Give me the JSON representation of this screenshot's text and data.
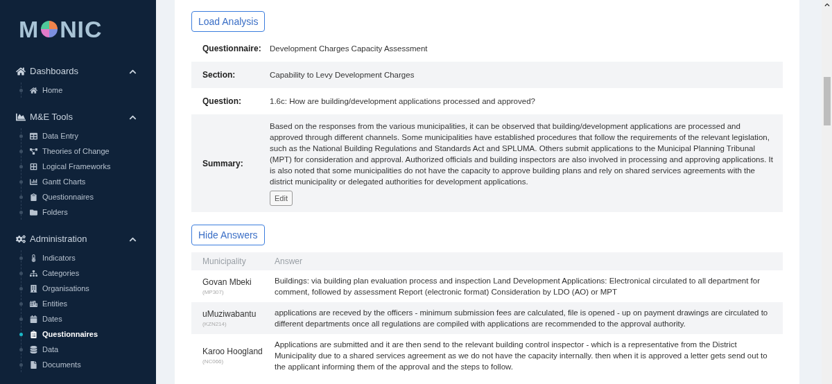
{
  "logo": {
    "before": "M",
    "after": "NIC"
  },
  "sidebar": {
    "sections": [
      {
        "title": "Dashboards",
        "expanded": true,
        "items": [
          {
            "label": "Home",
            "selected": false
          }
        ]
      },
      {
        "title": "M&E Tools",
        "expanded": true,
        "items": [
          {
            "label": "Data Entry",
            "selected": false
          },
          {
            "label": "Theories of Change",
            "selected": false
          },
          {
            "label": "Logical Frameworks",
            "selected": false
          },
          {
            "label": "Gantt Charts",
            "selected": false
          },
          {
            "label": "Questionnaires",
            "selected": false
          },
          {
            "label": "Folders",
            "selected": false
          }
        ]
      },
      {
        "title": "Administration",
        "expanded": true,
        "items": [
          {
            "label": "Indicators",
            "selected": false
          },
          {
            "label": "Categories",
            "selected": false
          },
          {
            "label": "Organisations",
            "selected": false
          },
          {
            "label": "Entities",
            "selected": false
          },
          {
            "label": "Dates",
            "selected": false
          },
          {
            "label": "Questionnaires",
            "selected": true
          },
          {
            "label": "Data",
            "selected": false
          },
          {
            "label": "Documents",
            "selected": false
          }
        ]
      }
    ]
  },
  "analysis": {
    "button": "Load Analysis",
    "details": [
      {
        "label": "Questionnaire:",
        "value": "Development Charges Capacity Assessment"
      },
      {
        "label": "Section:",
        "value": "Capability to Levy Development Charges"
      },
      {
        "label": "Question:",
        "value": "1.6c: How are building/development applications processed and approved?"
      },
      {
        "label": "Summary:",
        "value": "Based on the responses from the various municipalities, it can be observed that building/development applications are processed and approved through different channels. Some municipalities have established procedures that follow the requirements of the relevant legislation, such as the National Building Regulations and Standards Act and SPLUMA. Others submit applications to the Municipal Planning Tribunal (MPT) for consideration and approval. Authorized officials and building inspectors are also involved in processing and approving applications. It is also noted that some municipalities do not have the capacity to approve building plans and rely on shared services agreements with the district municipality or delegated authorities for development applications.",
        "edit_button": "Edit"
      }
    ]
  },
  "answers": {
    "button": "Hide Answers",
    "columns": [
      "Municipality",
      "Answer"
    ],
    "rows": [
      {
        "municipality": "Govan Mbeki",
        "code": "(MP307)",
        "answer": "Buildings: via building plan evaluation process and inspection Land Development Applications: Electronical circulated to all department for comment, followed by assessment Report (electronic format) Consideration by LDO (AO) or MPT"
      },
      {
        "municipality": "uMuziwabantu",
        "code": "(KZN214)",
        "answer": "applications are receved by the officers - minimum submission fees are calculated, file is opened - up on payment drawings are circulated to different departments once all regulations are compiled with applications are recommended to the approval authority."
      },
      {
        "municipality": "Karoo Hoogland",
        "code": "(NC066)",
        "answer": "Applications are submitted and it are then send to the relevant building control inspector - which is a representative from the District Municipality due to a shared services agreement as we do not have the capacity internally. then when it is approved a letter gets send out to the applicant informing them of the approval and the steps to follow."
      }
    ]
  }
}
